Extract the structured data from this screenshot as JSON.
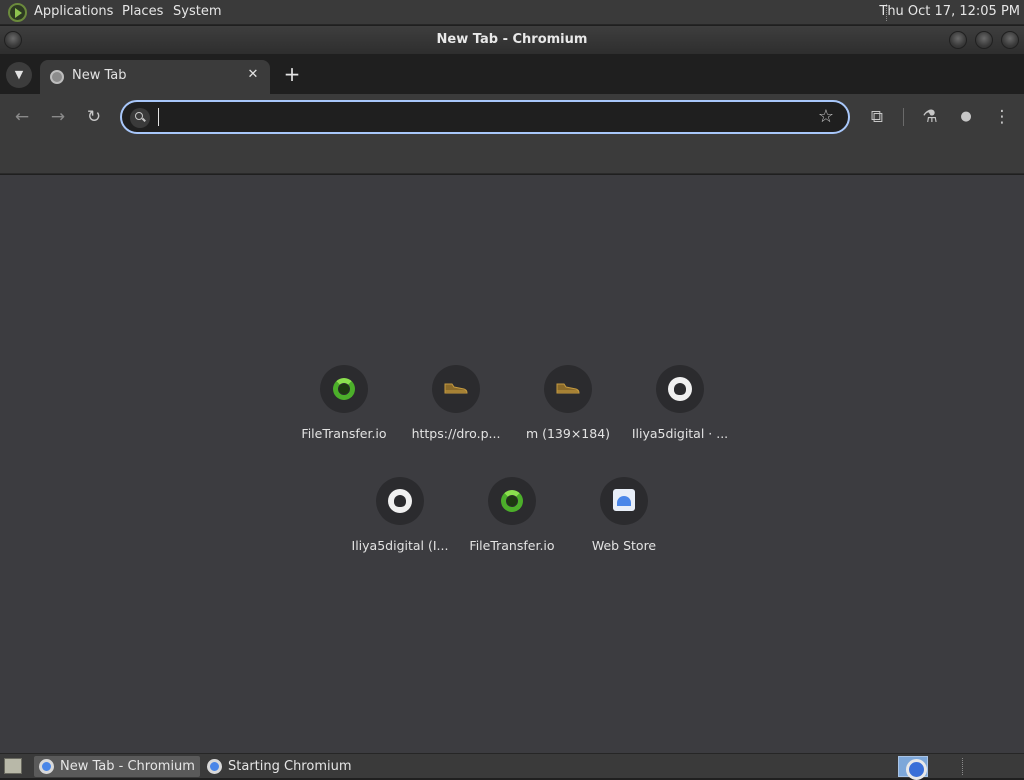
{
  "top_panel": {
    "menus": [
      "Applications",
      "Places",
      "System"
    ],
    "clock": "Thu Oct 17, 12:05 PM"
  },
  "window": {
    "title": "New Tab - Chromium"
  },
  "tabstrip": {
    "tab_search_icon": "chevron-down-icon",
    "tabs": [
      {
        "title": "New Tab",
        "favicon": "globe-icon",
        "close_glyph": "✕"
      }
    ],
    "new_tab_glyph": "+"
  },
  "toolbar": {
    "back_glyph": "←",
    "forward_glyph": "→",
    "reload_glyph": "↻",
    "omnibox": {
      "value": "",
      "placeholder": ""
    },
    "bookmark_glyph": "☆",
    "extensions_glyph": "⧉",
    "labs_glyph": "⚗",
    "profile_glyph": "●",
    "menu_glyph": "⋮"
  },
  "shortcuts": [
    {
      "label": "FileTransfer.io",
      "icon": "filetransfer-icon"
    },
    {
      "label": "https://dro.p...",
      "icon": "shoe-icon"
    },
    {
      "label": "m (139×184)",
      "icon": "shoe-icon"
    },
    {
      "label": "Iliya5digital · ...",
      "icon": "github-icon"
    },
    {
      "label": "Iliya5digital (I...",
      "icon": "github-icon"
    },
    {
      "label": "FileTransfer.io",
      "icon": "filetransfer-icon"
    },
    {
      "label": "Web Store",
      "icon": "webstore-icon"
    }
  ],
  "taskbar": {
    "tasks": [
      {
        "label": "New Tab - Chromium",
        "active": true
      },
      {
        "label": "Starting Chromium",
        "active": false
      }
    ]
  },
  "colors": {
    "accent": "#a8c7fa",
    "content_bg": "#3c3c40",
    "filetransfer_green": "#4caf2a",
    "shoe_brown": "#8a6a2a"
  }
}
